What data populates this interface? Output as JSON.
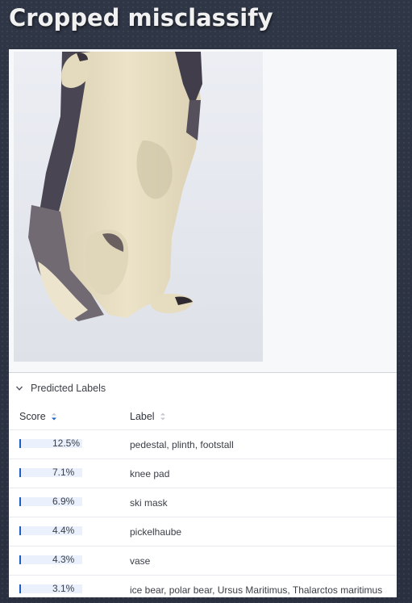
{
  "page": {
    "title": "Cropped misclassify"
  },
  "predictions": {
    "section_title": "Predicted Labels",
    "columns": {
      "score": "Score",
      "label": "Label"
    },
    "sort": {
      "column": "score",
      "direction": "descending"
    },
    "rows": [
      {
        "score": "12.5%",
        "fraction": 0.125,
        "label": "pedestal, plinth, footstall"
      },
      {
        "score": "7.1%",
        "fraction": 0.071,
        "label": "knee pad"
      },
      {
        "score": "6.9%",
        "fraction": 0.069,
        "label": "ski mask"
      },
      {
        "score": "4.4%",
        "fraction": 0.044,
        "label": "pickelhaube"
      },
      {
        "score": "4.3%",
        "fraction": 0.043,
        "label": "vase"
      },
      {
        "score": "3.1%",
        "fraction": 0.031,
        "label": "ice bear, polar bear, Ursus Maritimus, Thalarctos maritimus"
      }
    ]
  },
  "colors": {
    "bar_fill": "#1a5fc7",
    "bar_track": "#eaf1fc",
    "sort_active": "#1a5fc7"
  },
  "icons": {
    "collapse": "chevron-down-icon",
    "sort_active": "sort-descending-icon",
    "sort_inactive": "sort-icon"
  }
}
